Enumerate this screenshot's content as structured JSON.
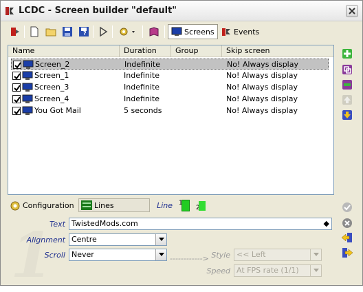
{
  "window": {
    "title": "LCDC - Screen builder \"default\""
  },
  "toolbar": {
    "screens_label": "Screens",
    "events_label": "Events"
  },
  "list": {
    "columns": [
      "Name",
      "Duration",
      "Group",
      "Skip screen"
    ],
    "rows": [
      {
        "name": "Screen_2",
        "duration": "Indefinite",
        "group": "",
        "skip": "No! Always display",
        "checked": true,
        "selected": true
      },
      {
        "name": "Screen_1",
        "duration": "Indefinite",
        "group": "",
        "skip": "No! Always display",
        "checked": true,
        "selected": false
      },
      {
        "name": "Screen_3",
        "duration": "Indefinite",
        "group": "",
        "skip": "No! Always display",
        "checked": true,
        "selected": false
      },
      {
        "name": "Screen_4",
        "duration": "Indefinite",
        "group": "",
        "skip": "No! Always display",
        "checked": true,
        "selected": false
      },
      {
        "name": "You Got Mail",
        "duration": "5 seconds",
        "group": "",
        "skip": "No! Always display",
        "checked": true,
        "selected": false
      }
    ]
  },
  "config": {
    "configuration_label": "Configuration",
    "lines_label": "Lines",
    "line_label": "Line",
    "line_numbers": [
      "1",
      "2"
    ],
    "text_label": "Text",
    "text_value": "TwistedMods.com",
    "alignment_label": "Alignment",
    "alignment_value": "Centre",
    "scroll_label": "Scroll",
    "scroll_value": "Never",
    "arrow_text": "------------>",
    "style_label": "Style",
    "style_value": "<< Left",
    "speed_label": "Speed",
    "speed_value": "At FPS rate (1/1)",
    "watermark": "1"
  },
  "colors": {
    "accent_green": "#22cc22",
    "label_blue": "#1f2f8f"
  }
}
